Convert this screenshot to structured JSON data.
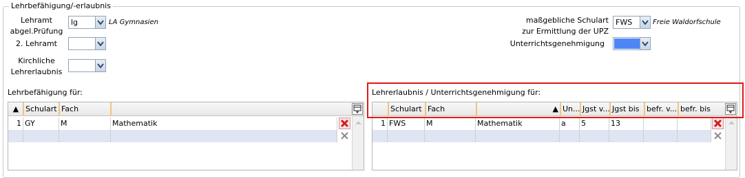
{
  "group": {
    "title": "Lehrbefähigung/-erlaubnis"
  },
  "form": {
    "lehramt_label_1": "Lehramt",
    "lehramt_label_2": "abgel.Prüfung",
    "lehramt_value": "lg",
    "lehramt_desc": "LA Gymnasien",
    "lehramt2_label": "2. Lehramt",
    "lehramt2_value": "",
    "kirchlich_label_1": "Kirchliche",
    "kirchlich_label_2": "Lehrerlaubnis",
    "kirchlich_value": "",
    "schulart_label_1": "maßgebliche Schulart",
    "schulart_label_2": "zur Ermittlung der UPZ",
    "schulart_value": "FWS",
    "schulart_desc": "Freie Waldorfschule",
    "ug_label": "Unterrichtsgenehmigung",
    "ug_color": "#4f86f7"
  },
  "left_grid": {
    "title": "Lehrbefähigung für:",
    "headers": {
      "sort": "▲",
      "schulart": "Schulart",
      "fach": "Fach",
      "desc": ""
    },
    "rows": [
      {
        "num": "1",
        "schulart": "GY",
        "fach": "M",
        "desc": "Mathematik"
      }
    ]
  },
  "right_grid": {
    "title": "Lehrerlaubnis / Unterrichtsgenehmigung für:",
    "headers": {
      "schulart": "Schulart",
      "fach": "Fach",
      "desc_sort": "▲",
      "un": "Un...",
      "jgst_von": "Jgst v...",
      "jgst_bis": "Jgst bis",
      "befr_von": "befr. v...",
      "befr_bis": "befr. bis"
    },
    "rows": [
      {
        "num": "1",
        "schulart": "FWS",
        "fach": "M",
        "desc": "Mathematik",
        "un": "a",
        "jgst_von": "5",
        "jgst_bis": "13",
        "befr_von": "",
        "befr_bis": ""
      }
    ]
  },
  "colors": {
    "new_row_bg": "#dfe5f2",
    "highlight": "#e01818",
    "header_sep": "#f3c37a"
  }
}
